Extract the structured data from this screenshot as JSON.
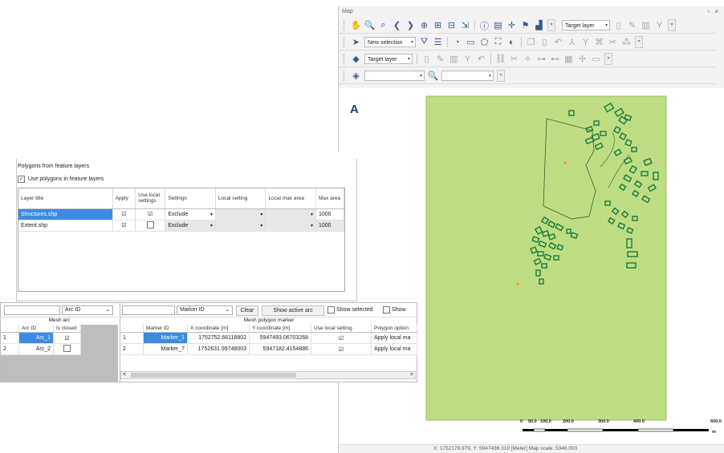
{
  "map": {
    "title": "Map",
    "window_controls": "▫ ×",
    "toolbar1": {
      "target_layer": "Target layer"
    },
    "toolbar2": {
      "selection": "New selection"
    },
    "toolbar3": {
      "target_layer": "Target layer"
    },
    "north_arrow": "A",
    "scale_labels": [
      "0",
      "50.0",
      "100.0",
      "200.0",
      "300.0",
      "400.0",
      "500.0"
    ],
    "scale_unit": "m",
    "status": "X: 1752178.979, Y: 5947436.319 [Meter]    Map scale: 5346.003",
    "colors": {
      "map_bg": "#bedd83",
      "feature_stroke": "#1a7a3c",
      "point": "#f0a030"
    }
  },
  "polygons": {
    "group_title": "Polygons from feature layers",
    "use_label": "Use polygons in feature layers",
    "headers": [
      "Layer title",
      "Apply",
      "Use local settings",
      "Settings",
      "Local setting",
      "Local max area",
      "Max area"
    ],
    "rows": [
      {
        "layer": "Structures.shp",
        "settings": "Exclude",
        "max_area": "1000",
        "apply": "☑",
        "local": "☑"
      },
      {
        "layer": "Extent.shp",
        "settings": "Exclude",
        "max_area": "1000",
        "apply": "☑",
        "local": ""
      }
    ]
  },
  "mesh_arc": {
    "filter_field": "Arc ID",
    "title": "Mesh arc",
    "headers": [
      "Arc ID",
      "Is closed"
    ],
    "rows": [
      {
        "num": "1",
        "id": "Arc_1",
        "closed": "☑"
      },
      {
        "num": "2",
        "id": "Arc_2",
        "closed": ""
      }
    ]
  },
  "mesh_marker": {
    "filter_field": "Marker ID",
    "clear": "Clear",
    "show_active": "Show active arc",
    "show_selected": "Show selected",
    "show_cut": "Show",
    "title": "Mesh polygon marker",
    "headers": [
      "Marker ID",
      "X coordinate [m]",
      "Y coordinate [m]",
      "Use local setting",
      "Polygon option"
    ],
    "rows": [
      {
        "num": "1",
        "id": "Marker_1",
        "x": "1752752.66118802",
        "y": "5947493.06703268",
        "use": "☑",
        "option": "Apply local ma"
      },
      {
        "num": "2",
        "id": "Marker_7",
        "x": "1752631.99748003",
        "y": "5947182.4154886",
        "use": "☑",
        "option": "Apply local ma"
      }
    ]
  }
}
